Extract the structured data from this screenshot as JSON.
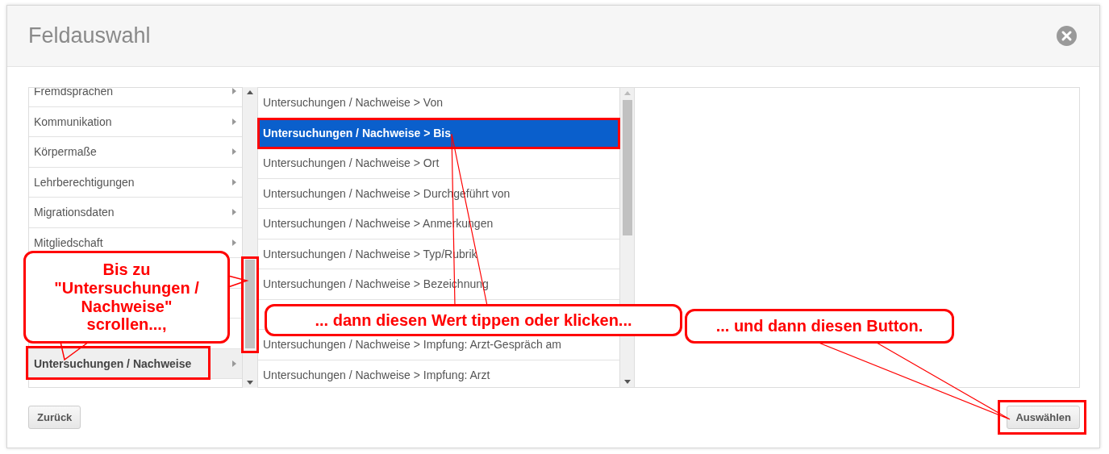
{
  "dialog": {
    "title": "Feldauswahl"
  },
  "categories": [
    {
      "label": "Fremdsprachen",
      "selected": false
    },
    {
      "label": "Kommunikation",
      "selected": false
    },
    {
      "label": "Körpermaße",
      "selected": false
    },
    {
      "label": "Lehrberechtigungen",
      "selected": false
    },
    {
      "label": "Migrationsdaten",
      "selected": false
    },
    {
      "label": "Mitgliedschaft",
      "selected": false
    },
    {
      "selected": false
    },
    {
      "selected": false
    },
    {
      "selected": false
    },
    {
      "label": "Untersuchungen / Nachweise",
      "selected": true
    }
  ],
  "fields": [
    {
      "label": "Untersuchungen / Nachweise > Von",
      "selected": false
    },
    {
      "label": "Untersuchungen / Nachweise > Bis",
      "selected": true
    },
    {
      "label": "Untersuchungen / Nachweise > Ort",
      "selected": false
    },
    {
      "label": "Untersuchungen / Nachweise > Durchgeführt von",
      "selected": false
    },
    {
      "label": "Untersuchungen / Nachweise > Anmerkungen",
      "selected": false
    },
    {
      "label": "Untersuchungen / Nachweise > Typ/Rubrik",
      "selected": false
    },
    {
      "label": "Untersuchungen / Nachweise > Bezeichnung",
      "selected": false
    },
    {
      "selected": false
    },
    {
      "label": "Untersuchungen / Nachweise > Impfung: Arzt-Gespräch am",
      "selected": false
    },
    {
      "label": "Untersuchungen / Nachweise > Impfung: Arzt",
      "selected": false
    }
  ],
  "buttons": {
    "back": "Zurück",
    "select": "Auswählen"
  },
  "annotations": [
    {
      "lines": [
        "Bis zu",
        "\"Untersuchungen /",
        "Nachweise\"",
        "scrollen...,"
      ]
    },
    {
      "lines": [
        "... dann diesen Wert tippen oder klicken..."
      ]
    },
    {
      "lines": [
        "... und dann diesen Button."
      ]
    }
  ]
}
